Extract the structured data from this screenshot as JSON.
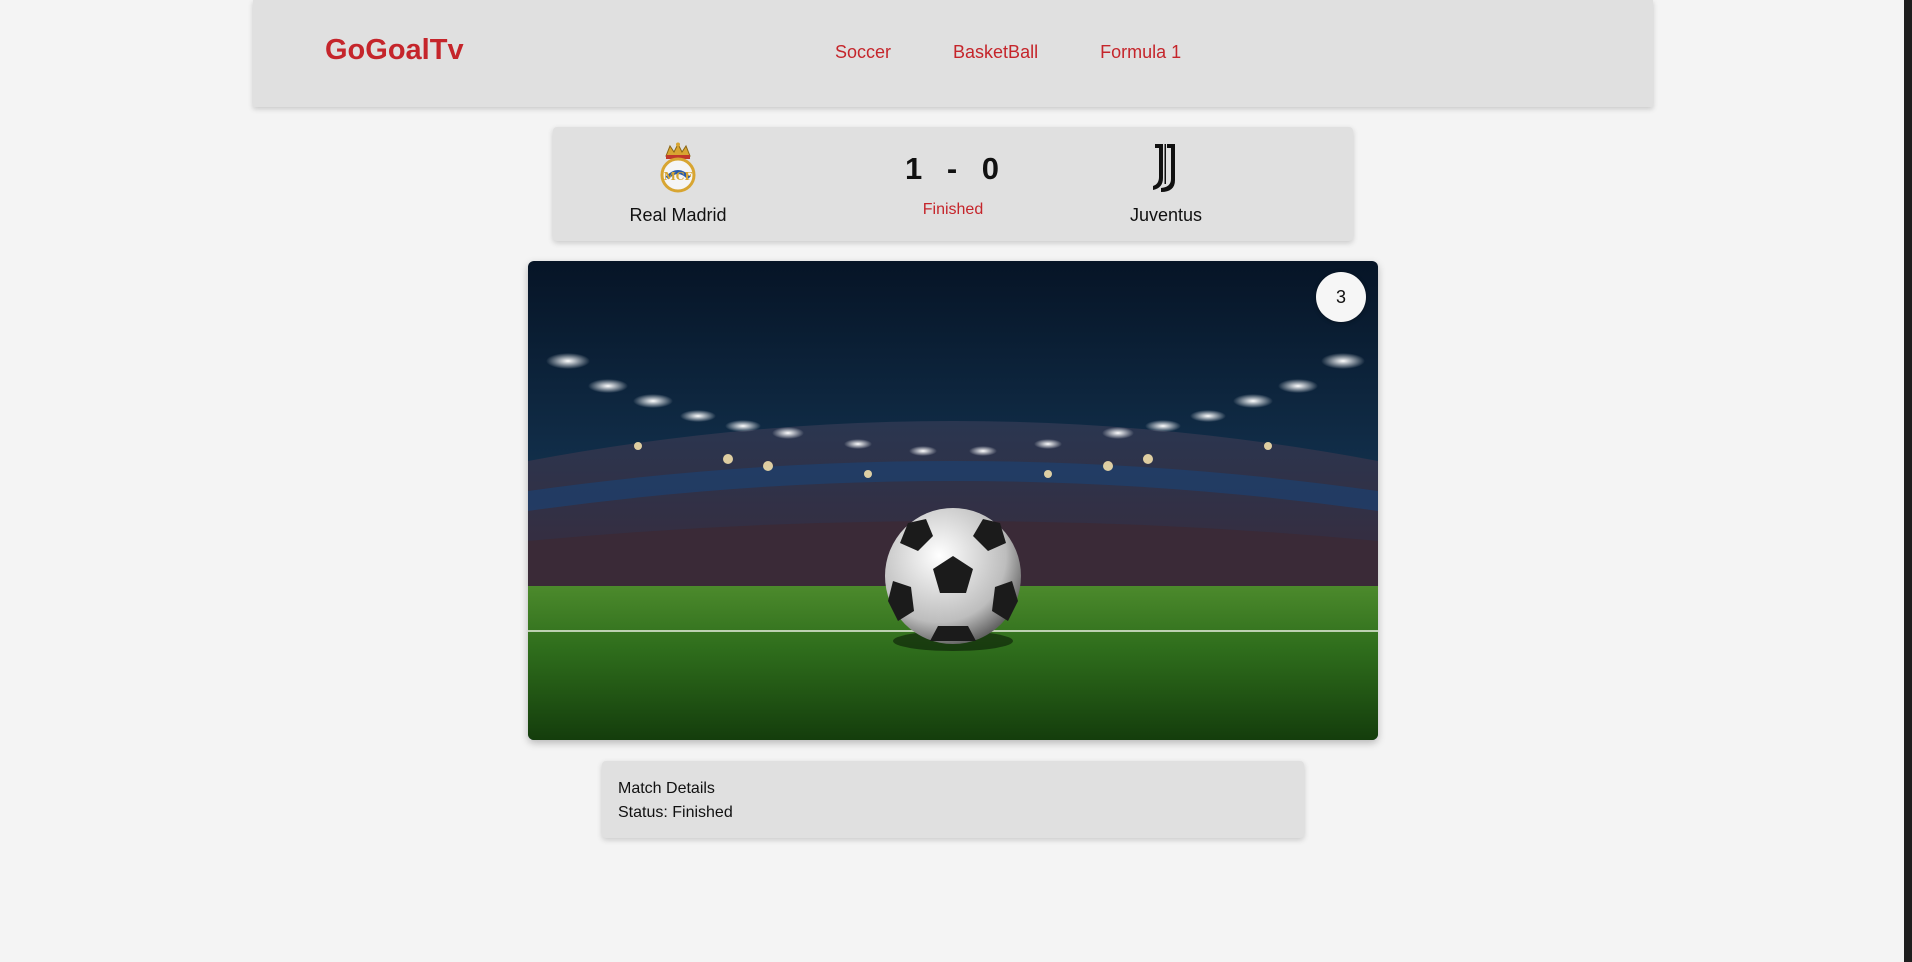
{
  "header": {
    "brand": "GoGoalTv",
    "nav": [
      "Soccer",
      "BasketBall",
      "Formula 1"
    ]
  },
  "match": {
    "home_team": "Real Madrid",
    "away_team": "Juventus",
    "home_score": "1",
    "separator": "-",
    "away_score": "0",
    "status": "Finished",
    "home_logo_icon": "real-madrid-crest-icon",
    "away_logo_icon": "juventus-logo-icon"
  },
  "hero": {
    "badge": "3"
  },
  "details": {
    "title": "Match Details",
    "status_line": "Status: Finished"
  },
  "colors": {
    "accent": "#c5252b",
    "panel": "#e0e0e0",
    "background": "#f4f4f4"
  }
}
